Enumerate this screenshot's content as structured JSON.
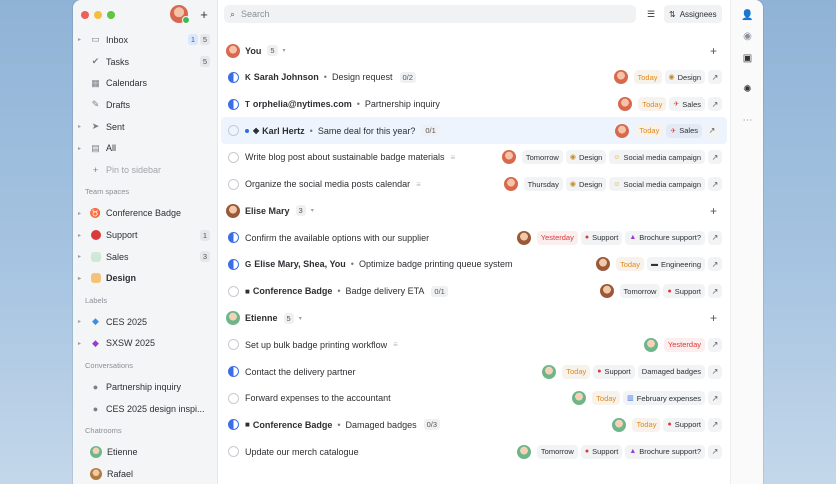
{
  "sidebar": {
    "nav": [
      {
        "label": "Inbox",
        "icon": "inbox-icon",
        "count_blue": "1",
        "count": "5"
      },
      {
        "label": "Tasks",
        "icon": "check-circle-icon",
        "count": "5"
      },
      {
        "label": "Calendars",
        "icon": "calendar-icon"
      },
      {
        "label": "Drafts",
        "icon": "pencil-icon"
      },
      {
        "label": "Sent",
        "icon": "send-icon"
      },
      {
        "label": "All",
        "icon": "stack-icon"
      },
      {
        "label": "Pin to sidebar",
        "icon": "plus-icon"
      }
    ],
    "team_spaces_label": "Team spaces",
    "team_spaces": [
      {
        "label": "Conference Badge",
        "icon": "badge-icon",
        "color": "#e25d4f"
      },
      {
        "label": "Support",
        "icon": "lifebuoy-icon",
        "color": "#d93a3a",
        "count": "1"
      },
      {
        "label": "Sales",
        "icon": "rocket-icon",
        "color": "#5dbb7a",
        "count": "3"
      },
      {
        "label": "Design",
        "icon": "palette-icon",
        "color": "#f0a23a"
      }
    ],
    "labels_label": "Labels",
    "labels": [
      {
        "label": "CES 2025",
        "color": "#3a8ee8"
      },
      {
        "label": "SXSW 2025",
        "color": "#9b3ad9"
      }
    ],
    "conversations_label": "Conversations",
    "conversations": [
      {
        "label": "Partnership inquiry"
      },
      {
        "label": "CES 2025 design inspi..."
      }
    ],
    "chatrooms_label": "Chatrooms",
    "chatrooms": [
      {
        "label": "Etienne"
      },
      {
        "label": "Rafael"
      }
    ]
  },
  "topbar": {
    "search_placeholder": "Search",
    "assignees_label": "Assignees"
  },
  "groups": [
    {
      "name": "You",
      "count": "5",
      "rows": [
        {
          "src": "K",
          "who": "Sarah Johnson",
          "title": "Design request",
          "cnt": "0/2",
          "status": "half",
          "date": "Today",
          "date_style": "orange",
          "tag": "Design",
          "tag_icon": "palette-icon"
        },
        {
          "src": "T",
          "who": "orphelia@nytimes.com",
          "title": "Partnership inquiry",
          "status": "half",
          "date": "Today",
          "date_style": "orange",
          "tag": "Sales",
          "tag_icon": "rocket-icon"
        },
        {
          "src": "◆",
          "who": "Karl Hertz",
          "title": "Same deal for this year?",
          "cnt": "0/1",
          "status": "empty",
          "unread": true,
          "highlight": true,
          "date": "Today",
          "date_style": "orange",
          "tag": "Sales",
          "tag_icon": "rocket-icon",
          "tag_active": true
        },
        {
          "title": "Write blog post about sustainable badge materials",
          "status": "empty",
          "note": true,
          "date": "Tomorrow",
          "date_style": "plain",
          "tag": "Design",
          "tag_icon": "palette-icon",
          "tag2": "Social media campaign",
          "tag2_icon": "megaphone-icon"
        },
        {
          "title": "Organize the social media posts calendar",
          "status": "empty",
          "note": true,
          "date": "Thursday",
          "date_style": "plain",
          "tag": "Design",
          "tag_icon": "palette-icon",
          "tag2": "Social media campaign",
          "tag2_icon": "megaphone-icon"
        }
      ]
    },
    {
      "name": "Elise Mary",
      "count": "3",
      "rows": [
        {
          "title": "Confirm the available options with our supplier",
          "status": "half",
          "date": "Yesterday",
          "date_style": "red",
          "tag": "Support",
          "tag_icon": "lifebuoy-icon",
          "tag2": "Brochure support?",
          "tag2_icon": "triangle-icon"
        },
        {
          "src": "G",
          "who": "Elise Mary, Shea, You",
          "title": "Optimize badge printing queue system",
          "status": "half",
          "date": "Today",
          "date_style": "orange",
          "tag": "Engineering",
          "tag_icon": "monitor-icon"
        },
        {
          "src": "■",
          "who": "Conference Badge",
          "title": "Badge delivery ETA",
          "cnt": "0/1",
          "status": "empty",
          "date": "Tomorrow",
          "date_style": "plain",
          "tag": "Support",
          "tag_icon": "lifebuoy-icon"
        }
      ]
    },
    {
      "name": "Etienne",
      "count": "5",
      "rows": [
        {
          "title": "Set up bulk badge printing workflow",
          "status": "empty",
          "note": true,
          "date": "Yesterday",
          "date_style": "red"
        },
        {
          "title": "Contact the delivery partner",
          "status": "half",
          "date": "Today",
          "date_style": "orange",
          "tag": "Support",
          "tag_icon": "lifebuoy-icon",
          "tag2": "Damaged badges",
          "tag2_icon": ""
        },
        {
          "title": "Forward expenses to the accountant",
          "status": "empty",
          "date": "Today",
          "date_style": "orange",
          "tag": "February expenses",
          "tag_icon": "chart-icon"
        },
        {
          "src": "■",
          "who": "Conference Badge",
          "title": "Damaged badges",
          "cnt": "0/3",
          "status": "half",
          "date": "Today",
          "date_style": "orange",
          "tag": "Support",
          "tag_icon": "lifebuoy-icon"
        },
        {
          "title": "Update our merch catalogue",
          "status": "empty",
          "date": "Tomorrow",
          "date_style": "plain",
          "tag": "Support",
          "tag_icon": "lifebuoy-icon",
          "tag2": "Brochure support?",
          "tag2_icon": "triangle-icon"
        }
      ]
    }
  ],
  "colors": {
    "accent_blue": "#3a6ee8",
    "today_orange": "#e08a1a",
    "yesterday_red": "#d93a3a"
  }
}
